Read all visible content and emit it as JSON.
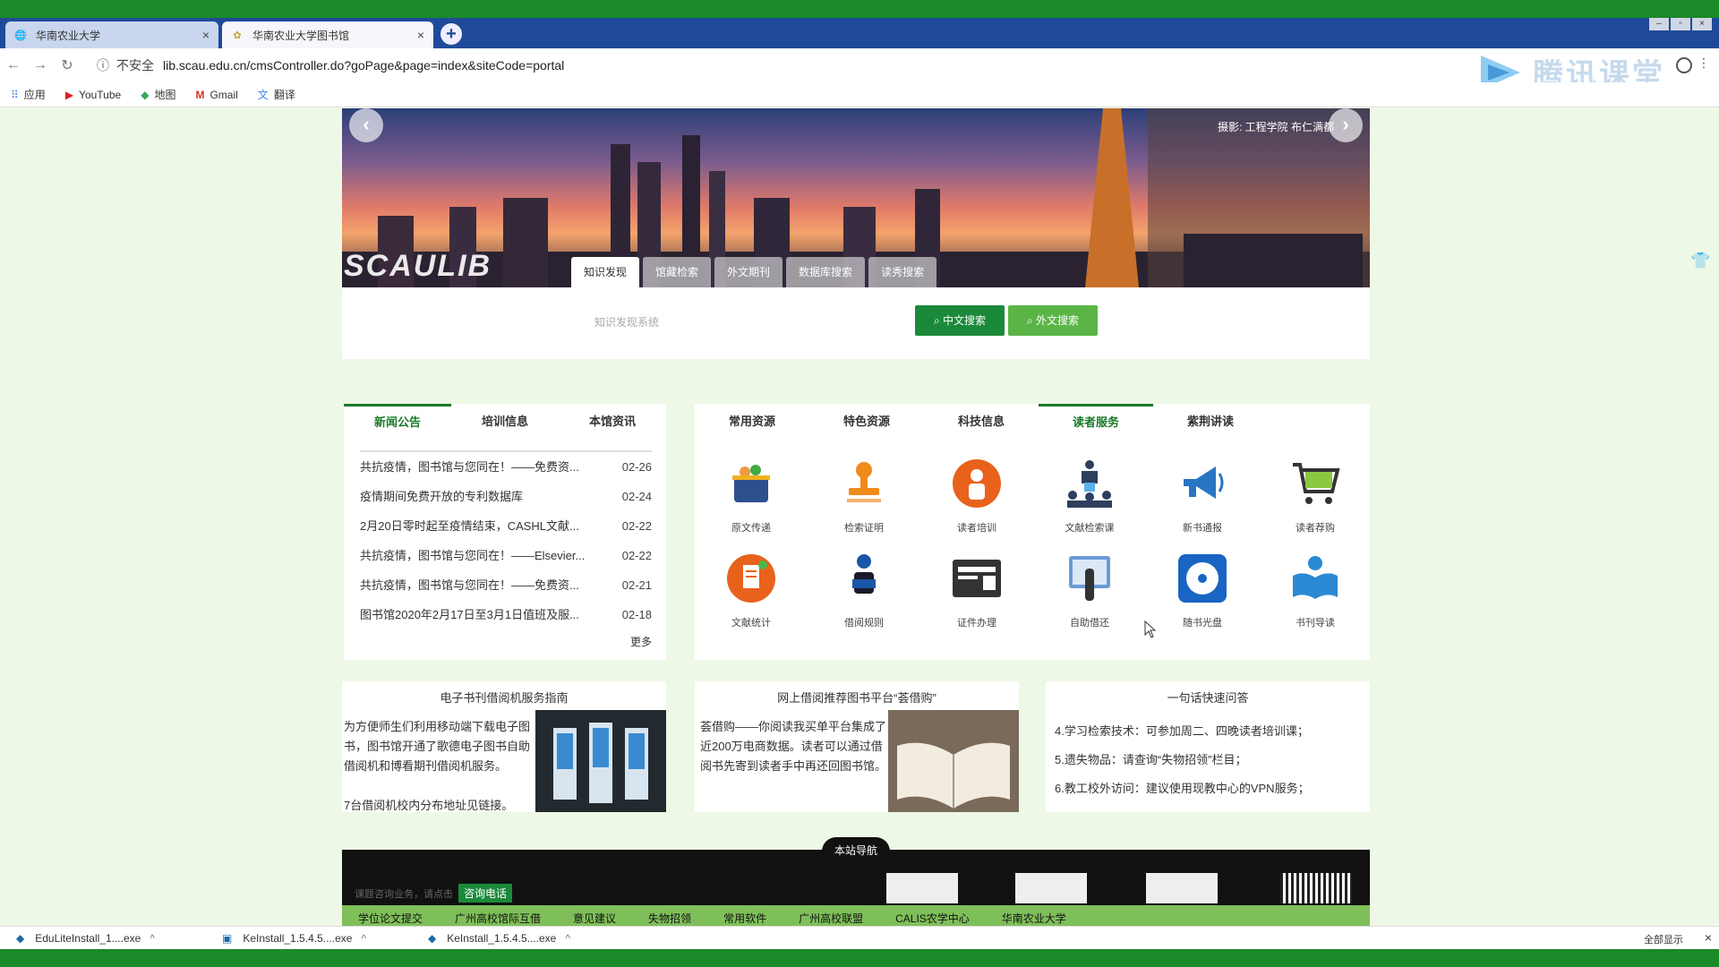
{
  "browser": {
    "tabs": [
      {
        "title": "华南农业大学",
        "close": "×"
      },
      {
        "title": "华南农业大学图书馆",
        "close": "×"
      }
    ],
    "new_tab": "+",
    "security_label": "不安全",
    "url": "lib.scau.edu.cn/cmsController.do?goPage&page=index&siteCode=portal",
    "overlay_brand": "腾讯课堂",
    "bookmarks": [
      {
        "icon": "apps-icon",
        "label": "应用"
      },
      {
        "icon": "youtube-icon",
        "label": "YouTube"
      },
      {
        "icon": "maps-icon",
        "label": "地图"
      },
      {
        "icon": "gmail-icon",
        "label": "Gmail"
      },
      {
        "icon": "translate-icon",
        "label": "翻译"
      }
    ]
  },
  "banner": {
    "credit": "摄影: 工程学院 布仁满都",
    "logo_text": "SCAULIB",
    "search_tabs": [
      "知识发现",
      "馆藏检索",
      "外文期刊",
      "数据库搜索",
      "读秀搜索"
    ],
    "active_tab": 0
  },
  "search": {
    "placeholder": "知识发现系统",
    "cn_button": "中文搜索",
    "fw_button": "外文搜索"
  },
  "news": {
    "tabs": [
      "新闻公告",
      "培训信息",
      "本馆资讯"
    ],
    "items": [
      {
        "title": "共抗疫情，图书馆与您同在！——免费资...",
        "date": "02-26"
      },
      {
        "title": "疫情期间免费开放的专利数据库",
        "date": "02-24"
      },
      {
        "title": "2月20日零时起至疫情结束，CASHL文献...",
        "date": "02-22"
      },
      {
        "title": "共抗疫情，图书馆与您同在！——Elsevier...",
        "date": "02-22"
      },
      {
        "title": "共抗疫情，图书馆与您同在！——免费资...",
        "date": "02-21"
      },
      {
        "title": "图书馆2020年2月17日至3月1日值班及服...",
        "date": "02-18"
      }
    ],
    "more": "更多"
  },
  "resources": {
    "tabs": [
      "常用资源",
      "特色资源",
      "科技信息",
      "读者服务",
      "紫荆讲读"
    ],
    "items": [
      {
        "label": "原文传递",
        "icon": "basket-icon"
      },
      {
        "label": "检索证明",
        "icon": "stamp-icon"
      },
      {
        "label": "读者培训",
        "icon": "trainer-icon"
      },
      {
        "label": "文献检索课",
        "icon": "lecture-icon"
      },
      {
        "label": "新书通报",
        "icon": "megaphone-icon"
      },
      {
        "label": "读者荐购",
        "icon": "cart-icon"
      },
      {
        "label": "文献统计",
        "icon": "document-stats-icon"
      },
      {
        "label": "借阅规则",
        "icon": "reader-icon"
      },
      {
        "label": "证件办理",
        "icon": "id-card-icon"
      },
      {
        "label": "自助借还",
        "icon": "touch-screen-icon"
      },
      {
        "label": "随书光盘",
        "icon": "disc-icon"
      },
      {
        "label": "书刊导读",
        "icon": "book-guide-icon"
      }
    ]
  },
  "info": {
    "ereader": {
      "title": "电子书刊借阅机服务指南",
      "body": "为方便师生们利用移动端下载电子图书，图书馆开通了歌德电子图书自助借阅机和博看期刊借阅机服务。",
      "body2": "7台借阅机校内分布地址见链接。"
    },
    "jieyuegou": {
      "title": "网上借阅推荐图书平台“荟借购”",
      "body": "荟借购——你阅读我买单平台集成了近200万电商数据。读者可以通过借阅书先寄到读者手中再还回图书馆。"
    },
    "faq": {
      "title": "一句话快速问答",
      "items": [
        "4.学习检索技术：可参加周二、四晚读者培训课；",
        "5.遗失物品：请查询“失物招领”栏目；",
        "6.教工校外访问：建议使用现教中心的VPN服务；"
      ]
    }
  },
  "footer": {
    "heading": "本站导航",
    "consult_text": "课题咨询业务，请点击",
    "consult_button": "咨询电话",
    "links": [
      "学位论文提交",
      "广州高校馆际互借",
      "意见建议",
      "失物招领",
      "常用软件",
      "广州高校联盟",
      "CALIS农学中心",
      "华南农业大学"
    ]
  },
  "downloads": {
    "items": [
      {
        "name": "EduLiteInstall_1....exe",
        "caret": "^"
      },
      {
        "name": "KeInstall_1.5.4.5....exe",
        "caret": "^"
      },
      {
        "name": "KeInstall_1.5.4.5....exe",
        "caret": "^"
      }
    ],
    "show_all": "全部显示",
    "close": "×"
  },
  "colors": {
    "primary": "#1a7a2a",
    "tabbar": "#1f4a99",
    "page_bg": "#eef8e6"
  }
}
